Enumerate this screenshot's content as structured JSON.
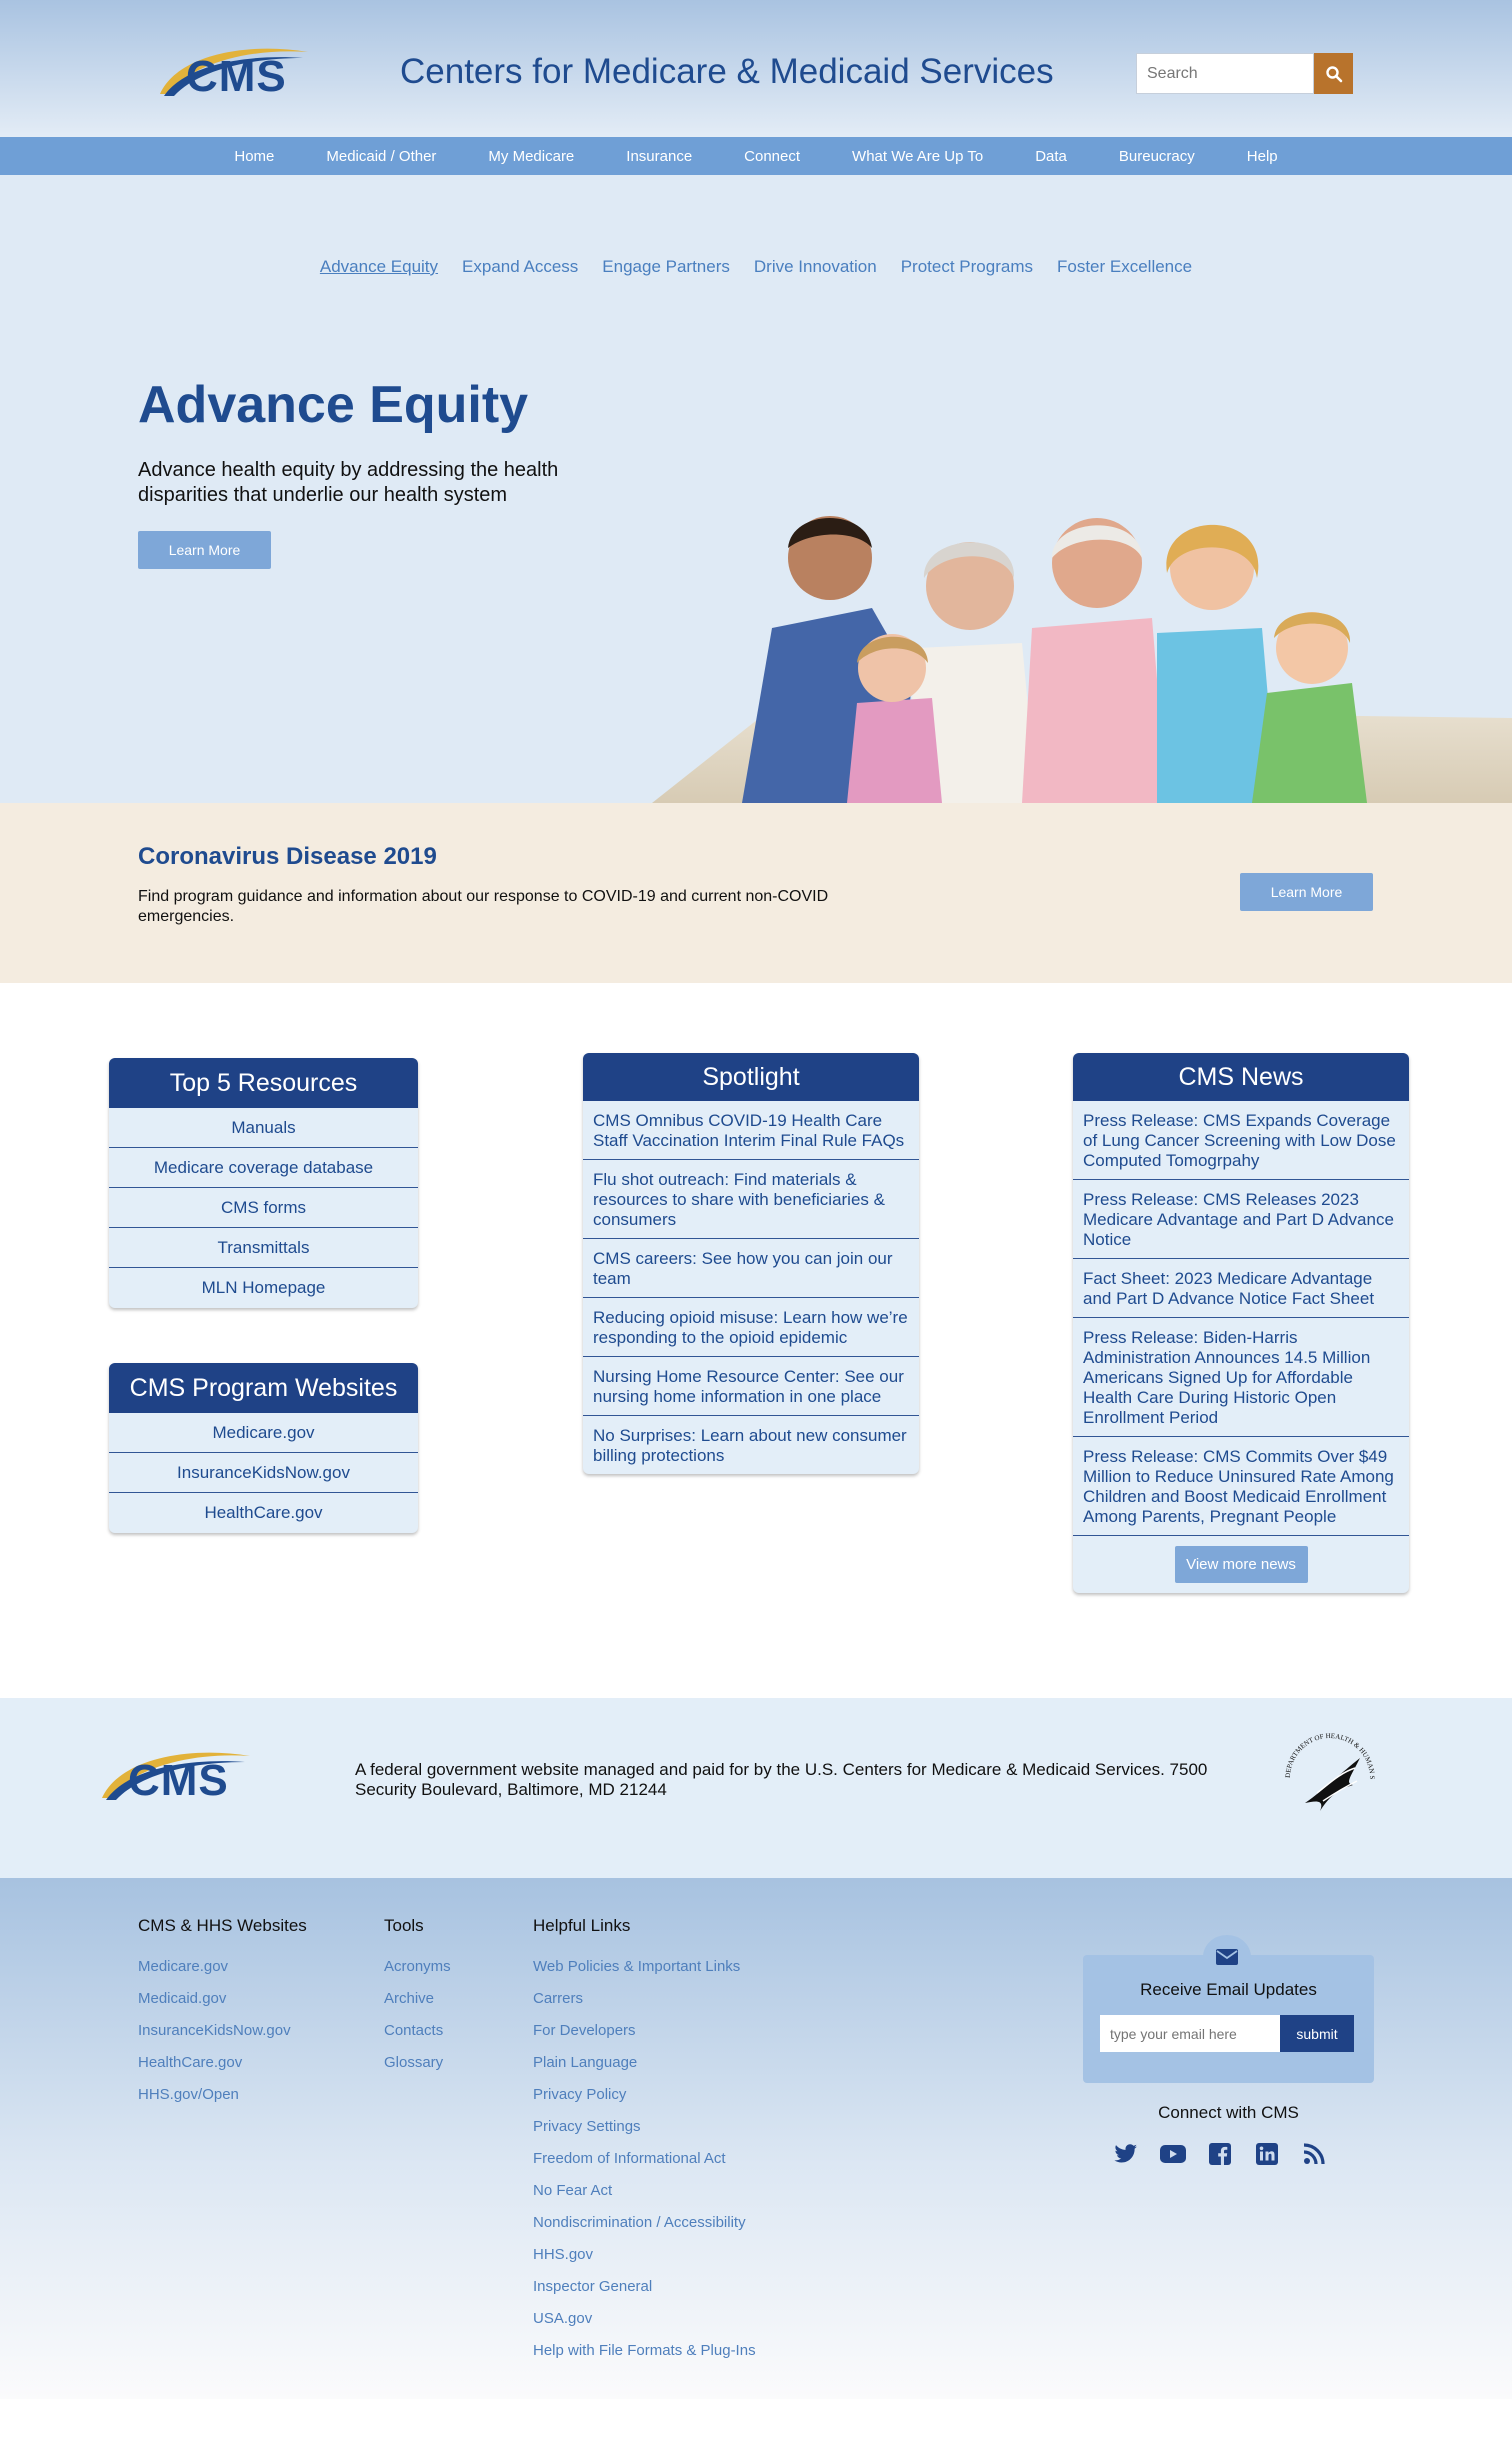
{
  "header": {
    "logo_text": "CMS",
    "title": "Centers for Medicare & Medicaid Services",
    "search_placeholder": "Search"
  },
  "topnav": [
    "Home",
    "Medicaid / Other",
    "My Medicare",
    "Insurance",
    "Connect",
    "What We Are Up To",
    "Data",
    "Bureucracy",
    "Help"
  ],
  "subnav": [
    "Advance Equity",
    "Expand Access",
    "Engage Partners",
    "Drive Innovation",
    "Protect Programs",
    "Foster Excellence"
  ],
  "hero": {
    "title": "Advance Equity",
    "description": "Advance health equity by addressing the health disparities that underlie our health system",
    "button": "Learn More"
  },
  "covid": {
    "title": "Coronavirus Disease 2019",
    "description": "Find program guidance and information about our response to COVID-19 and current non-COVID emergencies.",
    "button": "Learn More"
  },
  "resources": {
    "title": "Top 5 Resources",
    "items": [
      "Manuals",
      "Medicare coverage database",
      "CMS forms",
      "Transmittals",
      "MLN Homepage"
    ]
  },
  "program_sites": {
    "title": "CMS Program Websites",
    "items": [
      "Medicare.gov",
      "InsuranceKidsNow.gov",
      "HealthCare.gov"
    ]
  },
  "spotlight": {
    "title": "Spotlight",
    "items": [
      "CMS Omnibus COVID-19 Health Care Staff Vaccination Interim Final Rule FAQs",
      "Flu shot outreach: Find materials & resources to share with beneficiaries & consumers",
      "CMS careers: See how you can join our team",
      "Reducing opioid misuse: Learn how we’re responding to the opioid epidemic",
      "Nursing Home Resource Center: See our nursing home information in one place",
      "No Surprises: Learn about new consumer billing protections"
    ]
  },
  "news": {
    "title": "CMS News",
    "items": [
      "Press Release: CMS Expands Coverage of Lung Cancer Screening with Low Dose Computed Tomogrpahy",
      "Press Release: CMS Releases 2023 Medicare Advantage and Part D Advance Notice",
      "Fact Sheet: 2023 Medicare Advantage and Part D Advance Notice Fact Sheet",
      "Press Release: Biden-Harris Administration Announces 14.5 Million Americans Signed Up for Affordable Health Care During Historic Open Enrollment Period",
      "Press Release: CMS Commits Over $49 Million to Reduce Uninsured Rate Among Children and Boost Medicaid Enrollment Among Parents, Pregnant People"
    ],
    "more_button": "View more news"
  },
  "footer": {
    "logo_text": "CMS",
    "disclaimer": "A federal government website managed and paid for by the U.S. Centers for Medicare & Medicaid Services. 7500 Security Boulevard, Baltimore, MD 21244",
    "seal_text": "DEPARTMENT OF HEALTH & HUMAN SERVICES·USA",
    "columns": [
      {
        "title": "CMS & HHS Websites",
        "links": [
          "Medicare.gov",
          "Medicaid.gov",
          "InsuranceKidsNow.gov",
          "HealthCare.gov",
          "HHS.gov/Open"
        ]
      },
      {
        "title": "Tools",
        "links": [
          "Acronyms",
          "Archive",
          "Contacts",
          "Glossary"
        ]
      },
      {
        "title": "Helpful Links",
        "links": [
          "Web Policies & Important Links",
          "Carrers",
          "For Developers",
          "Plain Language",
          "Privacy Policy",
          "Privacy Settings",
          "Freedom of Informational Act",
          "No Fear Act",
          "Nondiscrimination / Accessibility",
          "HHS.gov",
          "Inspector General",
          "USA.gov",
          "Help with File Formats & Plug-Ins"
        ]
      }
    ],
    "email": {
      "title": "Receive Email Updates",
      "placeholder": "type your email here",
      "submit": "submit"
    },
    "connect_title": "Connect with CMS",
    "social_icons": [
      "twitter-icon",
      "youtube-icon",
      "facebook-icon",
      "linkedin-icon",
      "rss-icon"
    ]
  },
  "colors": {
    "brand_navy": "#1f4286",
    "link_blue": "#4a7fbf",
    "nav_blue": "#6f9fd6",
    "search_orange": "#b8732c",
    "hero_bg": "#dfeaf5",
    "covid_bg": "#f4ece0"
  }
}
